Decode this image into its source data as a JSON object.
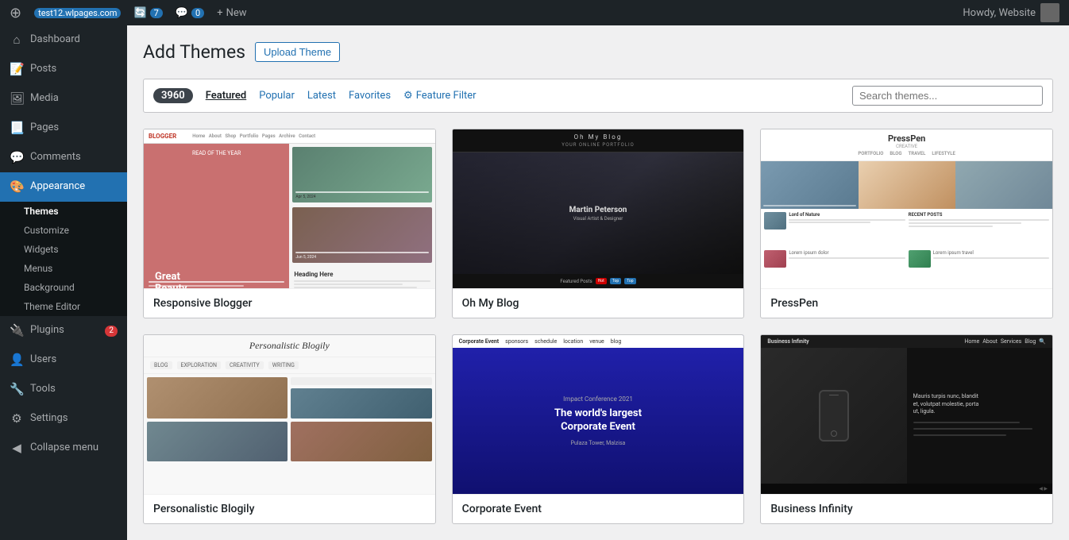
{
  "adminbar": {
    "site": "test12.wlpages.com",
    "updates": "7",
    "comments": "0",
    "new_label": "New",
    "howdy": "Howdy, Website"
  },
  "sidebar": {
    "menu_items": [
      {
        "id": "dashboard",
        "label": "Dashboard",
        "icon": "⌂",
        "active": false
      },
      {
        "id": "posts",
        "label": "Posts",
        "icon": "📄",
        "active": false
      },
      {
        "id": "media",
        "label": "Media",
        "icon": "🖼",
        "active": false
      },
      {
        "id": "pages",
        "label": "Pages",
        "icon": "📃",
        "active": false
      },
      {
        "id": "comments",
        "label": "Comments",
        "icon": "💬",
        "active": false
      },
      {
        "id": "appearance",
        "label": "Appearance",
        "icon": "🎨",
        "active": true
      }
    ],
    "submenu": [
      {
        "id": "themes",
        "label": "Themes",
        "active": true
      },
      {
        "id": "customize",
        "label": "Customize",
        "active": false
      },
      {
        "id": "widgets",
        "label": "Widgets",
        "active": false
      },
      {
        "id": "menus",
        "label": "Menus",
        "active": false
      },
      {
        "id": "background",
        "label": "Background",
        "active": false
      },
      {
        "id": "theme-editor",
        "label": "Theme Editor",
        "active": false
      }
    ],
    "bottom_menu": [
      {
        "id": "plugins",
        "label": "Plugins",
        "badge": "2"
      },
      {
        "id": "users",
        "label": "Users"
      },
      {
        "id": "tools",
        "label": "Tools"
      },
      {
        "id": "settings",
        "label": "Settings"
      },
      {
        "id": "collapse",
        "label": "Collapse menu"
      }
    ]
  },
  "main": {
    "title": "Add Themes",
    "upload_button": "Upload Theme",
    "theme_count": "3960",
    "filters": [
      {
        "id": "featured",
        "label": "Featured",
        "active": true
      },
      {
        "id": "popular",
        "label": "Popular",
        "active": false
      },
      {
        "id": "latest",
        "label": "Latest",
        "active": false
      },
      {
        "id": "favorites",
        "label": "Favorites",
        "active": false
      }
    ],
    "feature_filter_label": "Feature Filter",
    "search_placeholder": "Search themes...",
    "themes": [
      {
        "id": "responsive-blogger",
        "name": "Responsive Blogger",
        "preview_type": "blogger"
      },
      {
        "id": "oh-my-blog",
        "name": "Oh My Blog",
        "preview_type": "ohmyblog"
      },
      {
        "id": "presspen",
        "name": "PressPen",
        "preview_type": "presspen"
      },
      {
        "id": "personalistic-blogily",
        "name": "Personalistic Blogily",
        "preview_type": "blogily"
      },
      {
        "id": "corporate-event",
        "name": "Corporate Event",
        "preview_type": "corporate"
      },
      {
        "id": "business-infinity",
        "name": "Business Infinity",
        "preview_type": "business"
      }
    ]
  }
}
